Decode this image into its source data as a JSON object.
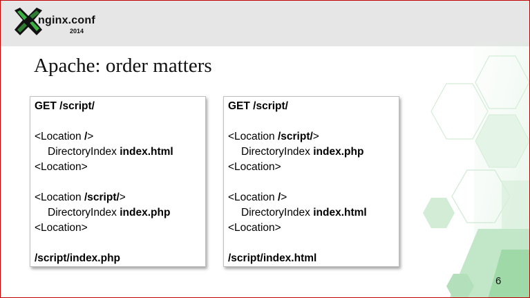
{
  "brand": {
    "name": "nginx.conf",
    "year": "2014",
    "accent_color": "#1a8c2e"
  },
  "slide": {
    "title": "Apache: order matters",
    "page_number": "6"
  },
  "panels": [
    {
      "request": "GET /script/",
      "block1": {
        "open_prefix": "<Location ",
        "path": "/",
        "open_suffix": ">",
        "directive": "DirectoryIndex ",
        "file": "index.html",
        "close": "<Location>"
      },
      "block2": {
        "open_prefix": "<Location ",
        "path": "/script/",
        "open_suffix": ">",
        "directive": "DirectoryIndex ",
        "file": "index.php",
        "close": "<Location>"
      },
      "result": "/script/index.php"
    },
    {
      "request": "GET /script/",
      "block1": {
        "open_prefix": "<Location ",
        "path": "/script/",
        "open_suffix": ">",
        "directive": "DirectoryIndex ",
        "file": "index.php",
        "close": "<Location>"
      },
      "block2": {
        "open_prefix": "<Location ",
        "path": "/",
        "open_suffix": ">",
        "directive": "DirectoryIndex ",
        "file": "index.html",
        "close": "<Location>"
      },
      "result": "/script/index.html"
    }
  ]
}
